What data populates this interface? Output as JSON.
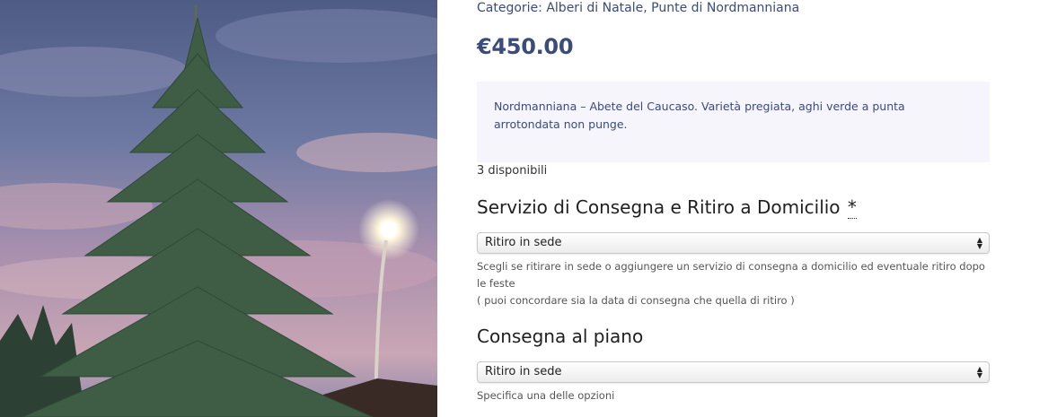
{
  "product": {
    "categories_label": "Categorie:",
    "categories": [
      "Alberi di Natale",
      "Punte di Nordmanniana"
    ],
    "categories_separator": ", ",
    "price": "€450.00",
    "description": "Nordmanniana – Abete del Caucaso. Varietà pregiata, aghi verde a punta arrotondata non punge.",
    "stock": "3 disponibili"
  },
  "fields": [
    {
      "title": "Servizio di Consegna e Ritiro a Domicilio",
      "required_mark": "*",
      "selected": "Ritiro in sede",
      "helper_lines": [
        "Scegli se ritirare in sede o aggiungere un servizio di consegna a domicilio ed eventuale ritiro dopo le feste",
        "( puoi concordare sia la data di consegna che quella di ritiro )"
      ]
    },
    {
      "title": "Consegna al piano",
      "selected": "Ritiro in sede",
      "helper_lines": [
        "Specifica una delle opzioni"
      ]
    }
  ],
  "icons": {
    "select_arrow": "up-down-chevron-icon"
  },
  "colors": {
    "accent": "#3b4b7a",
    "description_bg": "#f5f5fb",
    "heading": "#1f1f1f"
  }
}
